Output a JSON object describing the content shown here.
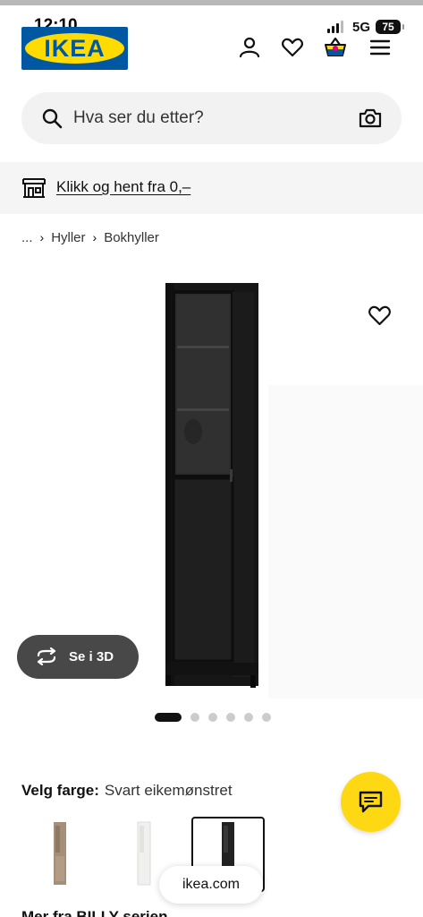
{
  "status_bar": {
    "time": "12:10",
    "network": "5G",
    "battery": "75"
  },
  "header": {
    "logo_text": "IKEA",
    "icons": [
      "user-icon",
      "heart-icon",
      "basket-icon",
      "menu-icon"
    ]
  },
  "search": {
    "placeholder": "Hva ser du etter?",
    "icons": [
      "search-icon",
      "camera-icon"
    ]
  },
  "promo": {
    "text": "Klikk og hent fra 0,–",
    "icon": "store-pickup-icon"
  },
  "breadcrumb": {
    "items": [
      "...",
      "Hyller",
      "Bokhyller"
    ]
  },
  "gallery": {
    "view_3d_label": "Se i 3D",
    "image_count": 6,
    "active_image": 1
  },
  "color_picker": {
    "label": "Velg farge:",
    "selected": "Svart eikemønstret",
    "swatches": [
      {
        "color": "#a89078",
        "selected": false
      },
      {
        "color": "#f0f0ee",
        "selected": false
      },
      {
        "color": "#222222",
        "selected": true
      }
    ]
  },
  "browser": {
    "url": "ikea.com"
  },
  "cut_text": "Mer fra BILLY serien",
  "colors": {
    "brand_blue": "#0058a3",
    "brand_yellow": "#ffdb00",
    "chat_yellow": "#ffd814"
  }
}
